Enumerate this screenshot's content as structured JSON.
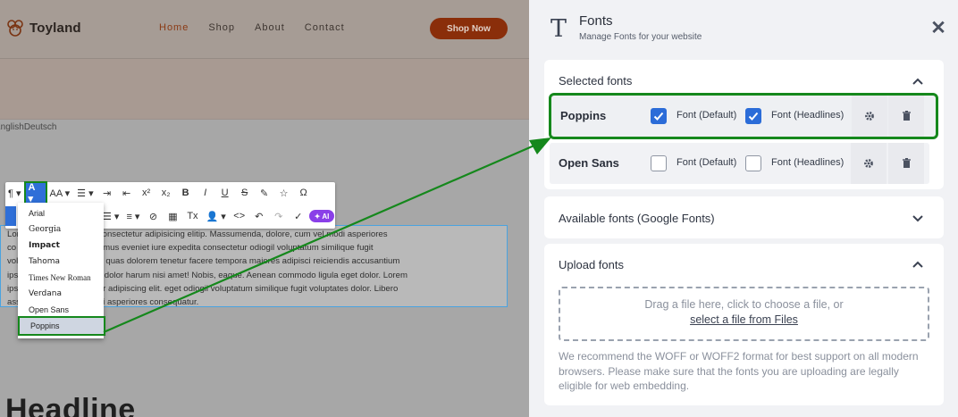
{
  "site": {
    "brand": "Toyland",
    "nav": [
      "Home",
      "Shop",
      "About",
      "Contact"
    ],
    "cta": "Shop Now",
    "languages": [
      "English",
      "Deutsch"
    ],
    "headline": "Headline"
  },
  "editor": {
    "toolbar": {
      "row1": [
        "¶ ▾",
        "A ▾",
        "AA ▾",
        "☰ ▾",
        "⇥",
        "⇤",
        "x²",
        "x₂",
        "B",
        "I",
        "U",
        "S",
        "✎",
        "☆",
        "Ω"
      ],
      "row2": [
        "",
        "☰ ▾",
        "≡ ▾",
        "⊘",
        "▦",
        "Tx",
        "👤 ▾",
        "<>",
        "↶",
        "↷",
        "✓"
      ],
      "ai_label": "✦ AI"
    },
    "font_dropdown": [
      "Arial",
      "Georgia",
      "Impact",
      "Tahoma",
      "Times New Roman",
      "Verdana",
      "Open Sans",
      "Poppins"
    ],
    "font_dropdown_selected": "Poppins",
    "paragraph_lines": [
      "Lor                  pe amet, consectetur adipisicing elitip. Massumenda, dolore, cum vel modi asperiores",
      "co                   uidem ducimus eveniet iure expedita consectetur odiogil voluptatum similique fugit",
      "vol                  amus quae quas dolorem tenetur facere tempora maiores adipisci reiciendis accusantium",
      "ips                  te tempore dolor harum nisi amet! Nobis, eaque. Aenean commodo ligula eget dolor. Lorem",
      "ips                  onsectetuer adipiscing elit. eget odiogil voluptatum similique fugit voluptates dolor. Libero",
      "ass                  m vel modi asperiores consequatur."
    ]
  },
  "panel": {
    "title": "Fonts",
    "subtitle": "Manage Fonts for your website",
    "selected_section": {
      "title": "Selected fonts",
      "fonts": [
        {
          "name": "Poppins",
          "default_label": "Font (Default)",
          "default_checked": true,
          "headlines_label": "Font (Headlines)",
          "headlines_checked": true
        },
        {
          "name": "Open Sans",
          "default_label": "Font (Default)",
          "default_checked": false,
          "headlines_label": "Font (Headlines)",
          "headlines_checked": false
        }
      ]
    },
    "available_section": {
      "title": "Available fonts (Google Fonts)"
    },
    "upload_section": {
      "title": "Upload fonts",
      "drop_text": "Drag a file here, click to choose a file, or",
      "select_link": "select a file from Files",
      "note": "We recommend the WOFF or WOFF2 format for best support on all modern browsers. Please make sure that the fonts you are uploading are legally eligible for web embedding."
    }
  },
  "colors": {
    "annotation_green": "#15881c",
    "checkbox_blue": "#2b6cd8",
    "cta_brown": "#8a2e0a"
  }
}
